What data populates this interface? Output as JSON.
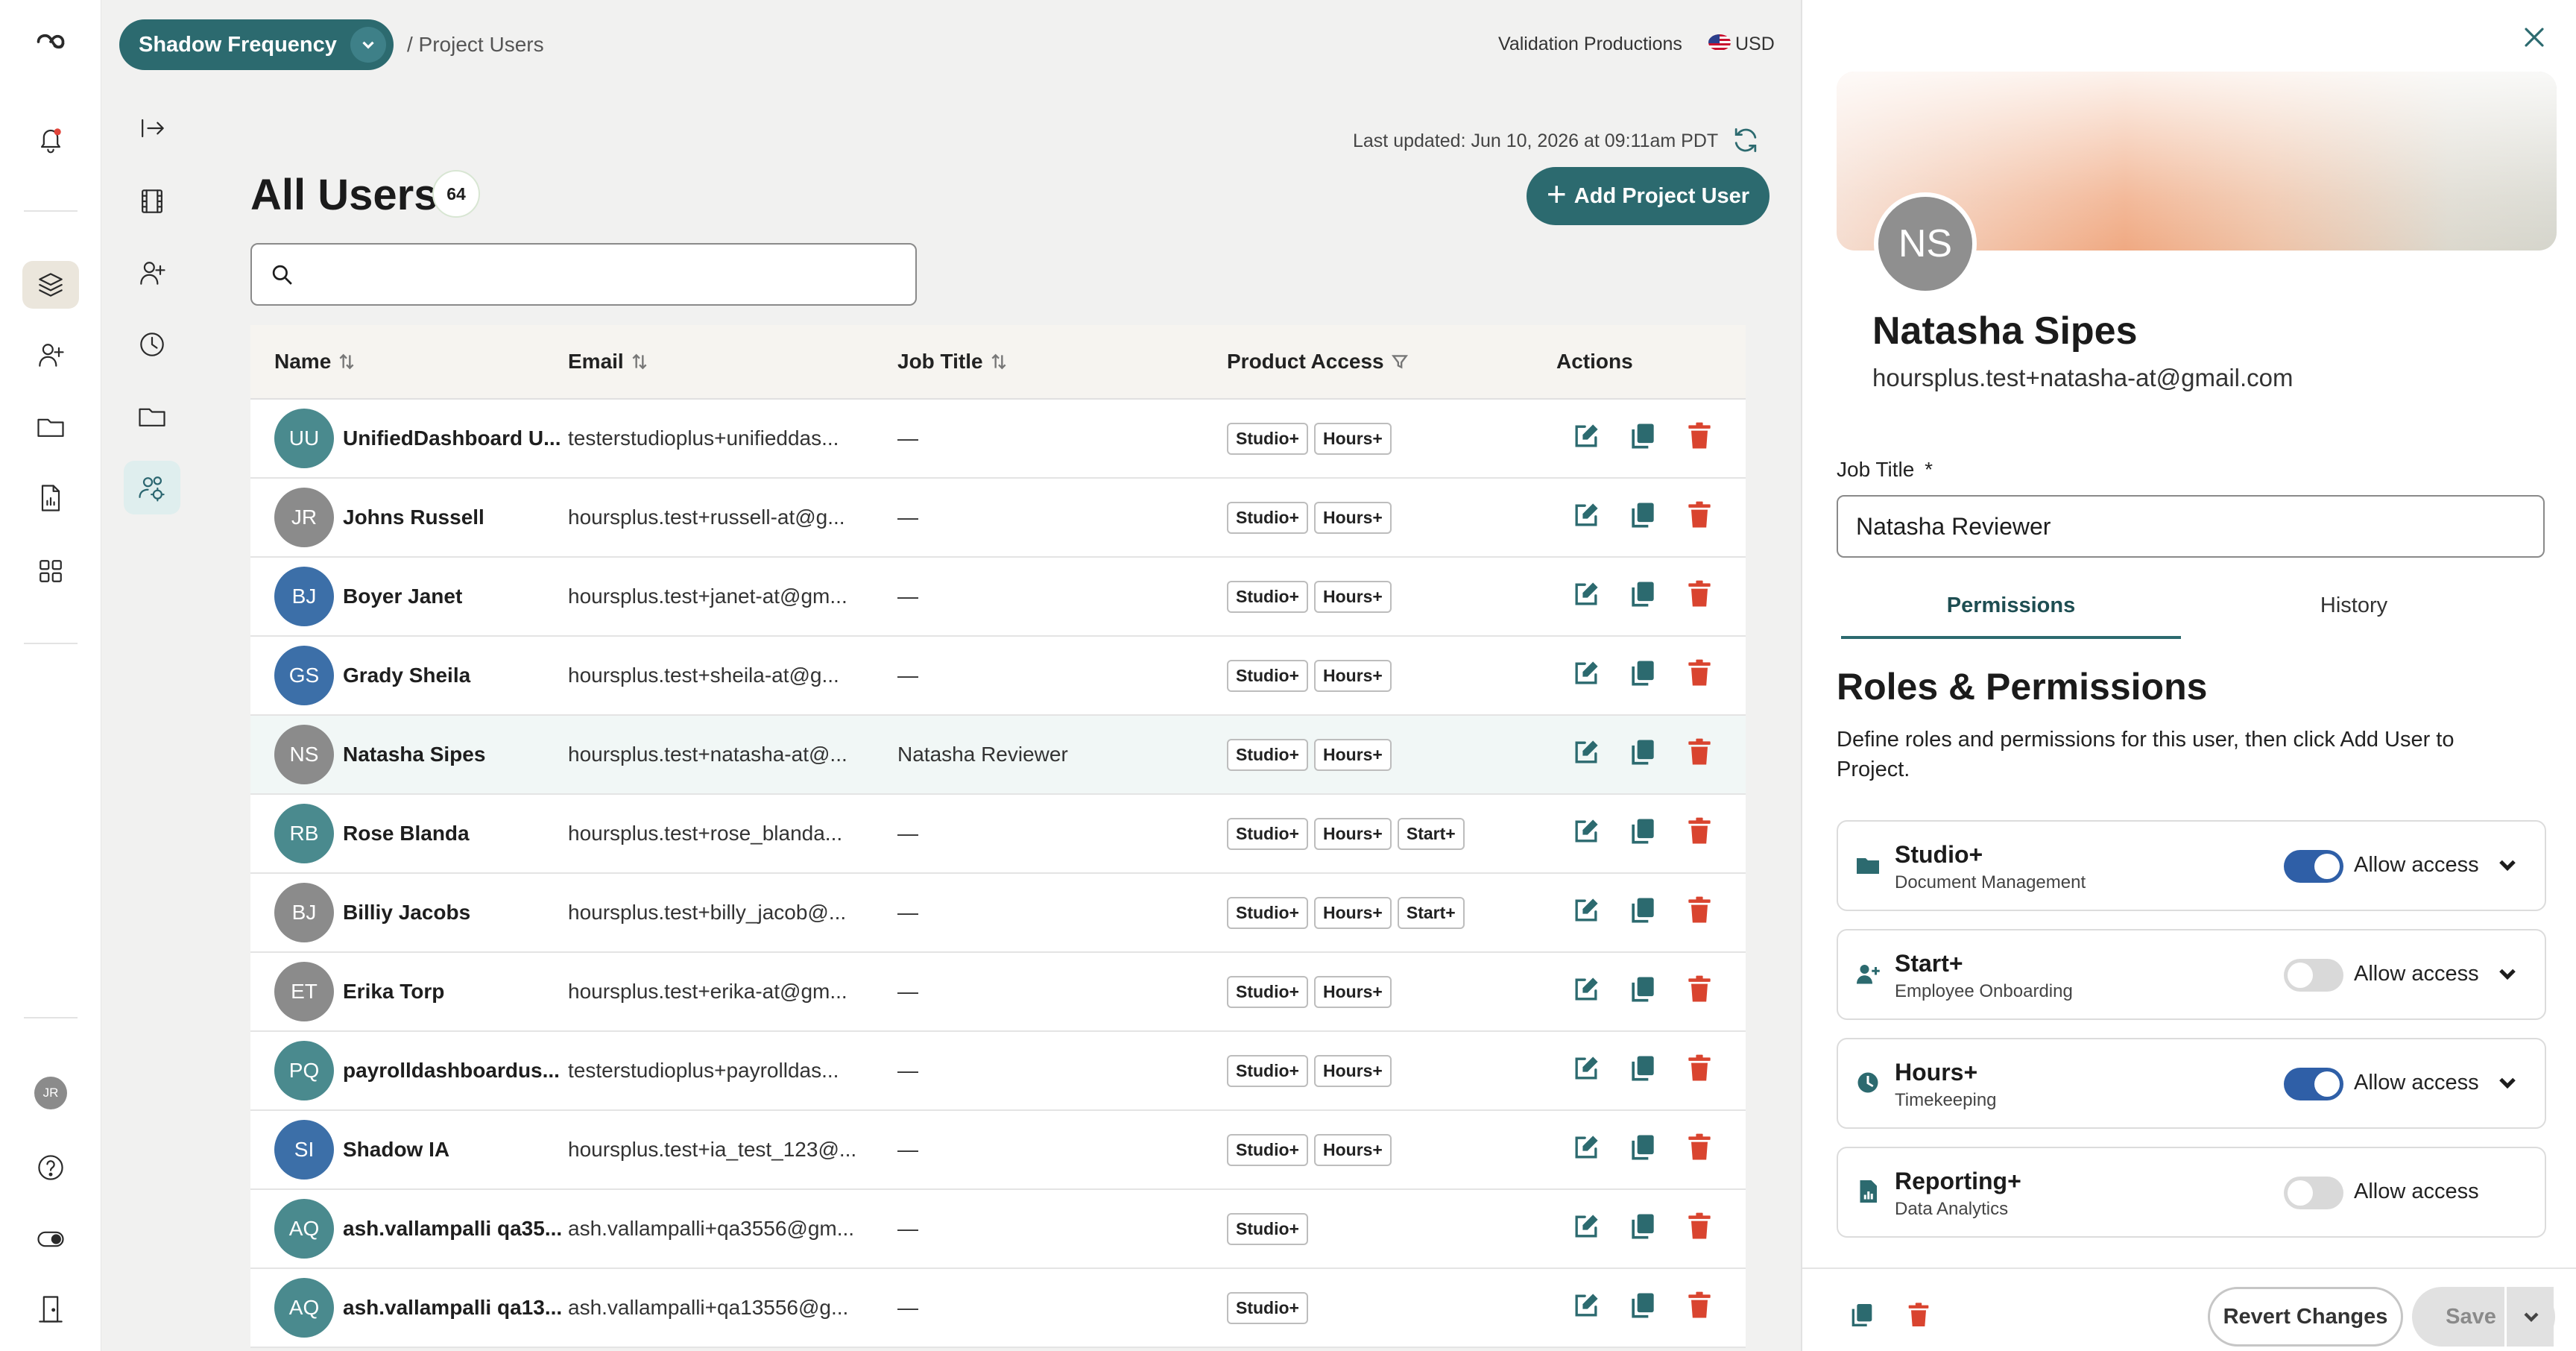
{
  "topbar": {
    "project_name": "Shadow Frequency",
    "breadcrumb": "/ Project Users",
    "company": "Validation Productions",
    "currency": "USD"
  },
  "main": {
    "last_updated": "Last updated: Jun 10, 2026 at 09:11am PDT",
    "title": "All Users",
    "count": "64",
    "add_button_label": "Add Project User",
    "search": {
      "value": "",
      "placeholder": ""
    }
  },
  "table": {
    "columns": [
      "Name",
      "Email",
      "Job Title",
      "Product Access",
      "Actions"
    ],
    "rows": [
      {
        "initials": "UU",
        "name": "UnifiedDashboard U...",
        "email": "testerstudioplus+unifieddas...",
        "job": "—",
        "access": [
          "Studio+",
          "Hours+"
        ],
        "color": "#4a8a8e"
      },
      {
        "initials": "JR",
        "name": "Johns Russell",
        "email": "hoursplus.test+russell-at@g...",
        "job": "—",
        "access": [
          "Studio+",
          "Hours+"
        ],
        "color": "#8b8b8b"
      },
      {
        "initials": "BJ",
        "name": "Boyer Janet",
        "email": "hoursplus.test+janet-at@gm...",
        "job": "—",
        "access": [
          "Studio+",
          "Hours+"
        ],
        "color": "#3c6fa8"
      },
      {
        "initials": "GS",
        "name": "Grady Sheila",
        "email": "hoursplus.test+sheila-at@g...",
        "job": "—",
        "access": [
          "Studio+",
          "Hours+"
        ],
        "color": "#3c6fa8"
      },
      {
        "initials": "NS",
        "name": "Natasha Sipes",
        "email": "hoursplus.test+natasha-at@...",
        "job": "Natasha Reviewer",
        "access": [
          "Studio+",
          "Hours+"
        ],
        "color": "#8b8b8b",
        "selected": true
      },
      {
        "initials": "RB",
        "name": "Rose Blanda",
        "email": "hoursplus.test+rose_blanda...",
        "job": "—",
        "access": [
          "Studio+",
          "Hours+",
          "Start+"
        ],
        "color": "#4a8a8e"
      },
      {
        "initials": "BJ",
        "name": "Billiy Jacobs",
        "email": "hoursplus.test+billy_jacob@...",
        "job": "—",
        "access": [
          "Studio+",
          "Hours+",
          "Start+"
        ],
        "color": "#8b8b8b"
      },
      {
        "initials": "ET",
        "name": "Erika Torp",
        "email": "hoursplus.test+erika-at@gm...",
        "job": "—",
        "access": [
          "Studio+",
          "Hours+"
        ],
        "color": "#8b8b8b"
      },
      {
        "initials": "PQ",
        "name": "payrolldashboardus...",
        "email": "testerstudioplus+payrolldas...",
        "job": "—",
        "access": [
          "Studio+",
          "Hours+"
        ],
        "color": "#4a8a8e"
      },
      {
        "initials": "SI",
        "name": "Shadow IA",
        "email": "hoursplus.test+ia_test_123@...",
        "job": "—",
        "access": [
          "Studio+",
          "Hours+"
        ],
        "color": "#3c6fa8"
      },
      {
        "initials": "AQ",
        "name": "ash.vallampalli qa35...",
        "email": "ash.vallampalli+qa3556@gm...",
        "job": "—",
        "access": [
          "Studio+"
        ],
        "color": "#4a8a8e"
      },
      {
        "initials": "AQ",
        "name": "ash.vallampalli qa13...",
        "email": "ash.vallampalli+qa13556@g...",
        "job": "—",
        "access": [
          "Studio+"
        ],
        "color": "#4a8a8e"
      }
    ]
  },
  "sidebar": {
    "user_initials": "JR"
  },
  "panel": {
    "initials": "NS",
    "name": "Natasha Sipes",
    "email": "hoursplus.test+natasha-at@gmail.com",
    "job_title_label": "Job Title",
    "required_mark": "*",
    "job_title_value": "Natasha Reviewer",
    "tabs": [
      "Permissions",
      "History"
    ],
    "roles_title": "Roles & Permissions",
    "roles_desc": "Define roles and permissions for this user, then click Add User to Project.",
    "permissions": [
      {
        "title": "Studio+",
        "sub": "Document Management",
        "allow": "Allow access",
        "on": true,
        "icon": "folder-icon",
        "chevron": true
      },
      {
        "title": "Start+",
        "sub": "Employee Onboarding",
        "allow": "Allow access",
        "on": false,
        "icon": "user-plus-icon",
        "chevron": true
      },
      {
        "title": "Hours+",
        "sub": "Timekeeping",
        "allow": "Allow access",
        "on": true,
        "icon": "clock-icon",
        "chevron": true
      },
      {
        "title": "Reporting+",
        "sub": "Data Analytics",
        "allow": "Allow access",
        "on": false,
        "icon": "report-icon",
        "chevron": false
      }
    ],
    "revert_label": "Revert Changes",
    "save_label": "Save"
  },
  "colors": {
    "accent": "#2c6a6f",
    "toggle_on": "#2f5fa7",
    "delete": "#d9442f"
  }
}
